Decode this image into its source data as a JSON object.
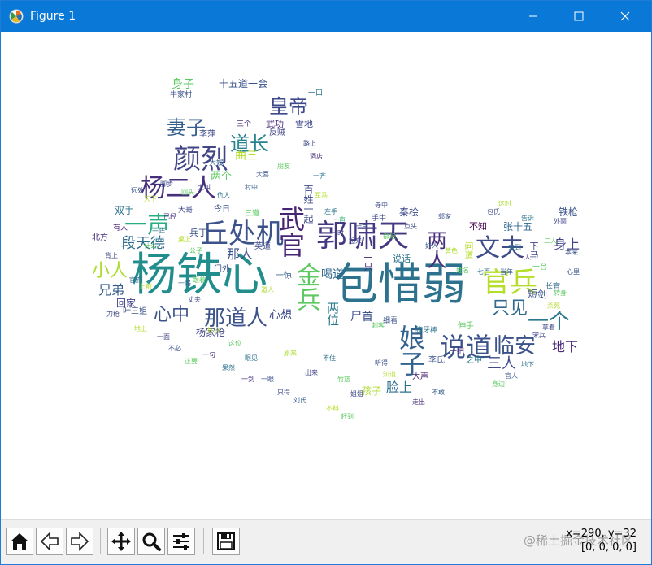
{
  "window": {
    "title": "Figure 1"
  },
  "status": {
    "coords": "x=290, y=32",
    "pixel_value": "[0, 0, 0, 0]"
  },
  "watermark": "@稀土掘金技术社区",
  "toolbar": {
    "buttons": [
      "home",
      "back",
      "forward",
      "pan",
      "zoom",
      "configure-subplots",
      "save"
    ]
  },
  "wordcloud": {
    "words": [
      {
        "text": "杨铁心",
        "color": "#218e8d"
      },
      {
        "text": "包惜弱",
        "color": "#2c728e"
      },
      {
        "text": "郭啸天",
        "color": "#453882"
      },
      {
        "text": "丘处机",
        "color": "#3b528b"
      },
      {
        "text": "杨二人",
        "color": "#46307e"
      },
      {
        "text": "颜烈",
        "color": "#414487"
      },
      {
        "text": "官兵",
        "color": "#b5de2b"
      },
      {
        "text": "说道",
        "color": "#3b528b"
      },
      {
        "text": "娘子",
        "color": "#33638d"
      },
      {
        "text": "文夫",
        "color": "#3e4c8a"
      },
      {
        "text": "武官",
        "color": "#482475"
      },
      {
        "text": "金兵",
        "color": "#5ec962"
      },
      {
        "text": "一声",
        "color": "#26ad81"
      },
      {
        "text": "那道人",
        "color": "#3b528b"
      },
      {
        "text": "临安",
        "color": "#3b528b"
      },
      {
        "text": "皇帝",
        "color": "#3e4989"
      },
      {
        "text": "道长",
        "color": "#25838e"
      },
      {
        "text": "妻子",
        "color": "#355f8d"
      },
      {
        "text": "一个",
        "color": "#2a788e"
      },
      {
        "text": "两人",
        "color": "#472d7b"
      },
      {
        "text": "小人",
        "color": "#addc30"
      },
      {
        "text": "心中",
        "color": "#3b528b"
      },
      {
        "text": "段天德",
        "color": "#2f6c8e"
      },
      {
        "text": "只见",
        "color": "#31688e"
      },
      {
        "text": "三人",
        "color": "#3e4989"
      },
      {
        "text": "身上",
        "color": "#414487"
      },
      {
        "text": "地下",
        "color": "#482878"
      },
      {
        "text": "那人",
        "color": "#3b528b"
      },
      {
        "text": "兄弟",
        "color": "#355f8d"
      },
      {
        "text": "心想",
        "color": "#3e4989"
      },
      {
        "text": "脸上",
        "color": "#2c728e"
      },
      {
        "text": "两位",
        "color": "#2a788e"
      },
      {
        "text": "尸首",
        "color": "#3b528b"
      },
      {
        "text": "喝道",
        "color": "#31688e"
      },
      {
        "text": "身子",
        "color": "#5ec962"
      },
      {
        "text": "曲三",
        "color": "#b5de2b"
      },
      {
        "text": "两个",
        "color": "#5ec962"
      },
      {
        "text": "十五道一会",
        "color": "#3b528b"
      },
      {
        "text": "武功",
        "color": "#472d7b"
      },
      {
        "text": "雪地",
        "color": "#3e4989"
      },
      {
        "text": "李萍",
        "color": "#3e4989"
      },
      {
        "text": "百姓一起",
        "color": "#3e4989"
      },
      {
        "text": "双手",
        "color": "#2c728e"
      },
      {
        "text": "北方",
        "color": "#472d7b"
      },
      {
        "text": "回家",
        "color": "#414487"
      },
      {
        "text": "叶三姐",
        "color": "#3b528b"
      },
      {
        "text": "杨家枪",
        "color": "#414487"
      },
      {
        "text": "孩子",
        "color": "#addc30"
      },
      {
        "text": "秦桧",
        "color": "#3e4989"
      },
      {
        "text": "铁枪",
        "color": "#3b528b"
      },
      {
        "text": "短剑",
        "color": "#3b528b"
      },
      {
        "text": "张十五",
        "color": "#31688e"
      },
      {
        "text": "不知",
        "color": "#440154"
      },
      {
        "text": "说话",
        "color": "#2c728e"
      },
      {
        "text": "一只",
        "color": "#482475"
      },
      {
        "text": "兵丁",
        "color": "#3b528b"
      },
      {
        "text": "英道",
        "color": "#3e4989"
      },
      {
        "text": "今日",
        "color": "#3b528b"
      },
      {
        "text": "一惊",
        "color": "#355f8d"
      },
      {
        "text": "大哥",
        "color": "#3e4989"
      },
      {
        "text": "三个",
        "color": "#472d7b"
      },
      {
        "text": "反贼",
        "color": "#414487"
      },
      {
        "text": "有人",
        "color": "#482475"
      },
      {
        "text": "背上",
        "color": "#414487"
      },
      {
        "text": "之中",
        "color": "#2a788e"
      },
      {
        "text": "李氏",
        "color": "#3b528b"
      },
      {
        "text": "伸手",
        "color": "#5ec962"
      },
      {
        "text": "一把",
        "color": "#472d7b"
      },
      {
        "text": "七百",
        "color": "#2c728e"
      },
      {
        "text": "当年",
        "color": "#355f8d"
      },
      {
        "text": "大声",
        "color": "#482475"
      },
      {
        "text": "牛家村",
        "color": "#3b528b"
      },
      {
        "text": "獠牙棒",
        "color": "#2c728e"
      },
      {
        "text": "细看",
        "color": "#3b528b"
      },
      {
        "text": "问道",
        "color": "#b5de2b"
      },
      {
        "text": "一台",
        "color": "#5ec962"
      },
      {
        "text": "二人",
        "color": "#5ec962"
      },
      {
        "text": "手中",
        "color": "#3e4989"
      },
      {
        "text": "郭家",
        "color": "#3b528b"
      },
      {
        "text": "大嫂",
        "color": "#355f8d"
      },
      {
        "text": "长官",
        "color": "#31688e"
      },
      {
        "text": "好汉",
        "color": "#b5de2b"
      },
      {
        "text": "一口",
        "color": "#2c728e"
      },
      {
        "text": "下马",
        "color": "#414487"
      },
      {
        "text": "寺中",
        "color": "#3e4989"
      },
      {
        "text": "三道",
        "color": "#5ec962"
      },
      {
        "text": "道人",
        "color": "#addc30"
      },
      {
        "text": "门外",
        "color": "#3b528b"
      },
      {
        "text": "桌上",
        "color": "#b5de2b"
      },
      {
        "text": "左手",
        "color": "#2c728e"
      },
      {
        "text": "点头",
        "color": "#3e4989"
      },
      {
        "text": "跟着",
        "color": "#5ec962"
      },
      {
        "text": "一声",
        "color": "#35b779"
      },
      {
        "text": "公子",
        "color": "#5ec962"
      },
      {
        "text": "黄色",
        "color": "#addc30"
      },
      {
        "text": "刺客",
        "color": "#5ec962"
      },
      {
        "text": "外面",
        "color": "#414487"
      },
      {
        "text": "本来",
        "color": "#3b528b"
      },
      {
        "text": "告诉",
        "color": "#2c728e"
      },
      {
        "text": "姓名",
        "color": "#5ec962"
      },
      {
        "text": "起来",
        "color": "#3e4989"
      },
      {
        "text": "上前",
        "color": "#b5de2b"
      },
      {
        "text": "一路",
        "color": "#355f8d"
      },
      {
        "text": "丈夫",
        "color": "#3e4989"
      },
      {
        "text": "一句",
        "color": "#472d7b"
      },
      {
        "text": "这位",
        "color": "#5ec962"
      },
      {
        "text": "眼见",
        "color": "#2c728e"
      },
      {
        "text": "一眼",
        "color": "#3b528b"
      },
      {
        "text": "原来",
        "color": "#addc30"
      },
      {
        "text": "出来",
        "color": "#414487"
      },
      {
        "text": "不住",
        "color": "#2c728e"
      },
      {
        "text": "竹篮",
        "color": "#5ec962"
      },
      {
        "text": "姐姐",
        "color": "#3e4989"
      },
      {
        "text": "听得",
        "color": "#3b528b"
      },
      {
        "text": "知道",
        "color": "#b5de2b"
      },
      {
        "text": "走出",
        "color": "#472d7b"
      },
      {
        "text": "不敢",
        "color": "#355f8d"
      },
      {
        "text": "身边",
        "color": "#5ec962"
      },
      {
        "text": "官人",
        "color": "#3b528b"
      },
      {
        "text": "地下",
        "color": "#2c728e"
      },
      {
        "text": "宋兵",
        "color": "#414487"
      },
      {
        "text": "拿着",
        "color": "#3e4989"
      },
      {
        "text": "杀死",
        "color": "#b5de2b"
      },
      {
        "text": "转身",
        "color": "#5ec962"
      },
      {
        "text": "心里",
        "color": "#3b528b"
      },
      {
        "text": "一人",
        "color": "#472d7b"
      },
      {
        "text": "来到",
        "color": "#2c728e"
      },
      {
        "text": "包氏",
        "color": "#3e4989"
      },
      {
        "text": "这时",
        "color": "#addc30"
      },
      {
        "text": "好人",
        "color": "#355f8d"
      },
      {
        "text": "都是",
        "color": "#5ec962"
      },
      {
        "text": "一片",
        "color": "#3b528b"
      },
      {
        "text": "一时",
        "color": "#414487"
      },
      {
        "text": "一齐",
        "color": "#2c728e"
      },
      {
        "text": "军马",
        "color": "#b5de2b"
      },
      {
        "text": "路上",
        "color": "#3e4989"
      },
      {
        "text": "酒店",
        "color": "#472d7b"
      },
      {
        "text": "朋友",
        "color": "#5ec962"
      },
      {
        "text": "大喜",
        "color": "#3b528b"
      },
      {
        "text": "村中",
        "color": "#355f8d"
      },
      {
        "text": "仇人",
        "color": "#2c728e"
      },
      {
        "text": "大叫",
        "color": "#414487"
      },
      {
        "text": "回头",
        "color": "#5ec962"
      },
      {
        "text": "脚步",
        "color": "#3e4989"
      },
      {
        "text": "天下",
        "color": "#addc30"
      },
      {
        "text": "远处",
        "color": "#3b528b"
      },
      {
        "text": "已经",
        "color": "#472d7b"
      },
      {
        "text": "一阵",
        "color": "#2c728e"
      },
      {
        "text": "什么",
        "color": "#5ec962"
      },
      {
        "text": "官府",
        "color": "#355f8d"
      },
      {
        "text": "刀枪",
        "color": "#3e4989"
      },
      {
        "text": "地上",
        "color": "#b5de2b"
      },
      {
        "text": "一面",
        "color": "#414487"
      },
      {
        "text": "不必",
        "color": "#3b528b"
      },
      {
        "text": "正要",
        "color": "#5ec962"
      },
      {
        "text": "果然",
        "color": "#2c728e"
      },
      {
        "text": "一剑",
        "color": "#472d7b"
      },
      {
        "text": "只得",
        "color": "#3e4989"
      },
      {
        "text": "刘氏",
        "color": "#355f8d"
      },
      {
        "text": "不料",
        "color": "#b5de2b"
      },
      {
        "text": "赶到",
        "color": "#5ec962"
      }
    ]
  }
}
